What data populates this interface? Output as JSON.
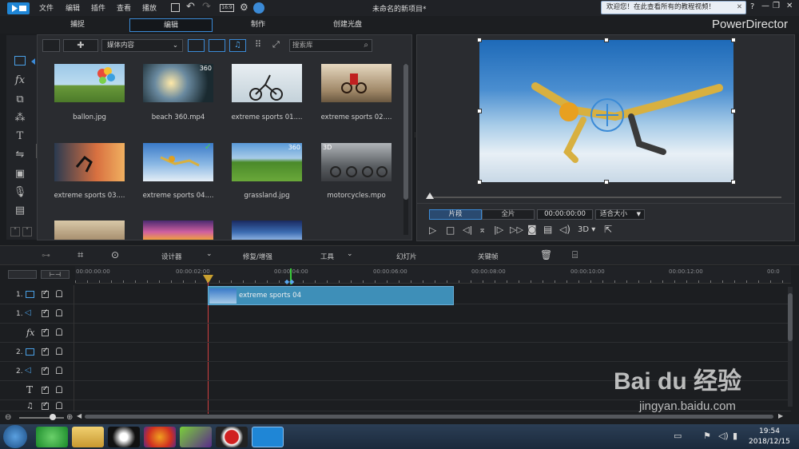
{
  "menu": [
    "文件",
    "编辑",
    "插件",
    "查看",
    "播放"
  ],
  "project_title": "未命名的新项目*",
  "help_banner": "欢迎您！在此查看所有的教程视频！",
  "help_q": "?",
  "app_name": "PowerDirector",
  "mode_tabs": [
    "捕捉",
    "编辑",
    "制作",
    "创建光盘"
  ],
  "library": {
    "filter_value": "媒体内容",
    "search_placeholder": "搜索库",
    "items": [
      {
        "name": "ballon.jpg",
        "badge": ""
      },
      {
        "name": "beach 360.mp4",
        "badge": "360"
      },
      {
        "name": "extreme sports 01....",
        "badge": ""
      },
      {
        "name": "extreme sports 02....",
        "badge": ""
      },
      {
        "name": "extreme sports 03....",
        "badge": ""
      },
      {
        "name": "extreme sports 04....",
        "badge": "✓"
      },
      {
        "name": "grassland.jpg",
        "badge": "360"
      },
      {
        "name": "motorcycles.mpo",
        "badge": "3D"
      }
    ]
  },
  "preview": {
    "mode_clip": "片段",
    "mode_movie": "全片",
    "timecode": "00:00:00:00",
    "fit": "适合大小",
    "threeD": "3D"
  },
  "tools": {
    "designer": "设计器",
    "fix": "修复/增强",
    "tools": "工具",
    "slideshow": "幻灯片",
    "keyframe": "关键帧"
  },
  "ruler": [
    "00:00:00:00",
    "00:00:02:00",
    "00:00:04:00",
    "00:00:06:00",
    "00:00:08:00",
    "00:00:10:00",
    "00:00:12:00",
    "00:0"
  ],
  "tracks": [
    {
      "label": "1.",
      "icon": "video-track-icon"
    },
    {
      "label": "1.",
      "icon": "audio-track-icon"
    },
    {
      "label": "fx",
      "icon": "fx-track-icon"
    },
    {
      "label": "2.",
      "icon": "video-track-icon"
    },
    {
      "label": "2.",
      "icon": "audio-track-icon"
    },
    {
      "label": "T",
      "icon": "title-track-icon"
    },
    {
      "label": "",
      "icon": "voice-track-icon"
    }
  ],
  "clip_label": "extreme sports 04",
  "taskbar": {
    "time": "19:54",
    "date": "2018/12/15"
  },
  "watermark": {
    "brand": "Bai du 经验",
    "url": "jingyan.baidu.com"
  },
  "colors": {
    "accent": "#3b8ad6",
    "clip": "#3e8fb8",
    "playhead": "#d04040"
  }
}
